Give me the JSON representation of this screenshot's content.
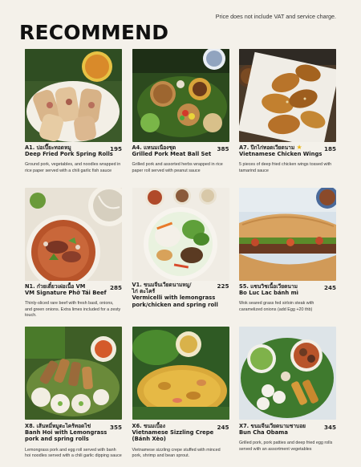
{
  "header": {
    "note": "Price does not include VAT and service charge.",
    "title": "RECOMMEND"
  },
  "items": [
    {
      "code_th": "A1. ปอเปี๊ยะทอดหมู",
      "name_en": "Deep Fried Pork Spring Rolls",
      "price": "195",
      "desc": "Ground pork, vegetables, and noodles wrapped in rice paper served with a chili garlic fish sauce"
    },
    {
      "code_th": "A4. แหนมเนืองชุด",
      "name_en": "Grilled Pork Meat Ball Set",
      "price": "385",
      "desc": "Grilled pork and assorted herbs wrapped in rice paper roll served with peanut sauce"
    },
    {
      "code_th": "A7. ปีกไก่ทอดเวียดนาม",
      "name_en": "Vietnamese Chicken Wings",
      "price": "185",
      "star": "★",
      "desc": "5 pieces of deep fried chicken wings tossed with tamarind sauce"
    },
    {
      "code_th": "N1. ก๋วยเตี๋ยวเฝอเนื้อ VM",
      "name_en": "VM Signature Phở Tái Beef",
      "price": "285",
      "desc": "Thinly-sliced rare beef with fresh basil, onions, and green onions. Extra limes included for a zesty touch."
    },
    {
      "code_th": "V1. ขนมจีนเวียดนามหมู/",
      "code_th2": "ไก่ ตะไคร้",
      "name_en": "Vermicelli with lemongrass",
      "name_en2": "pork/chicken and spring roll",
      "price": "225",
      "desc": ""
    },
    {
      "code_th": "S5. แซนวิชเนื้อเวียดนาม",
      "name_en": "Bo Luc Lac bánh mì",
      "price": "245",
      "desc": "Wok seared grass fed sirloin steak with caramelized onions (add Egg +20 thb)"
    },
    {
      "code_th": "X8. เส้นหมี่หมูตะไคร้ทอดไข่",
      "name_en": "Banh Hoi with Lemongrass",
      "name_en2": "pork and spring rolls",
      "price": "355",
      "desc": "Lemongrass pork and egg roll served with banh hoi noodles served with a chili garlic dipping sauce"
    },
    {
      "code_th": "X6. ขนมเบื้อง",
      "name_en": "Vietnamese Sizzling Crepe",
      "name_en2": "(Bánh Xèo)",
      "price": "245",
      "desc": "Vietnamese sizzling crepe stuffed with minced pork, shrimp and bean sprout."
    },
    {
      "code_th": "X7. ขนมจีนเวียดนามชาบอย",
      "name_en": "Bun Cha Obama",
      "price": "345",
      "desc": "Grilled pork, pork patties and deep fried egg rolls served with an assortment vegetables"
    }
  ]
}
